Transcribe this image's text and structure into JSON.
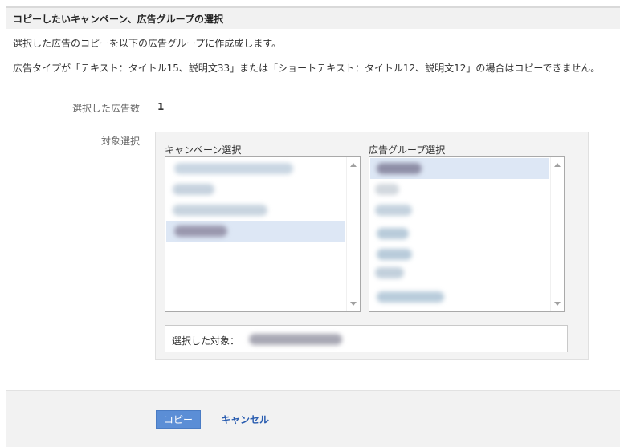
{
  "header": {
    "title": "コピーしたいキャンペーン、広告グループの選択"
  },
  "description": {
    "line1": "選択した広告のコピーを以下の広告グループに作成成します。",
    "line2": "広告タイプが「テキスト：タイトル15、説明文33」または「ショートテキスト：タイトル12、説明文12」の場合はコピーできません。"
  },
  "selected_ad_count": {
    "label": "選択した広告数",
    "value": "1"
  },
  "target_selection": {
    "label": "対象選択",
    "campaign_list": {
      "title": "キャンペーン選択",
      "selected_index": 3,
      "item_count": 4
    },
    "ad_group_list": {
      "title": "広告グループ選択",
      "selected_index": 0,
      "item_count": 7
    },
    "selected_target_label": "選択した対象："
  },
  "actions": {
    "copy_label": "コピー",
    "cancel_label": "キャンセル"
  },
  "colors": {
    "accent": "#5b8ed6",
    "link": "#2a5db0",
    "selection": "#dde7f5"
  }
}
